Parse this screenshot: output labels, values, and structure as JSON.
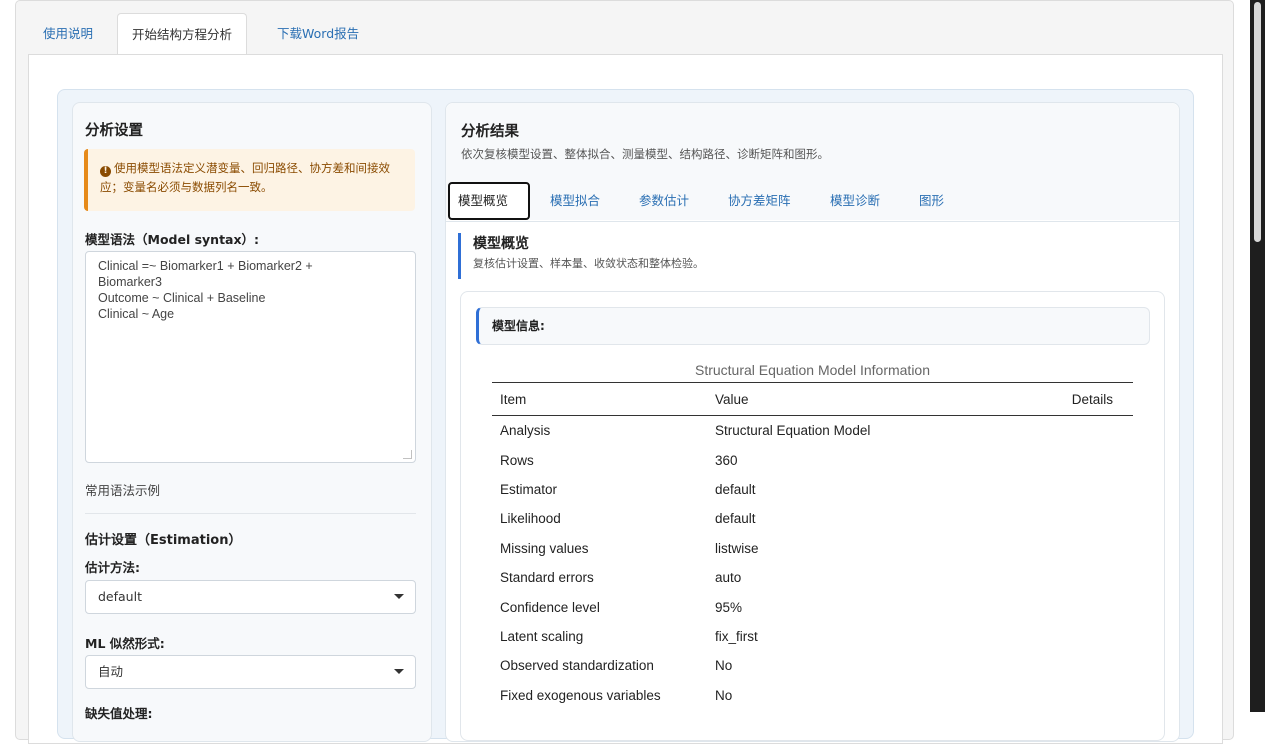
{
  "top_tabs": [
    {
      "label": "使用说明"
    },
    {
      "label": "开始结构方程分析"
    },
    {
      "label": "下载Word报告"
    }
  ],
  "settings": {
    "title": "分析设置",
    "notice": "使用模型语法定义潜变量、回归路径、协方差和间接效应；变量名必须与数据列名一致。",
    "syntax_label": "模型语法（Model syntax）:",
    "syntax_value": "Clinical =~ Biomarker1 + Biomarker2 +\nBiomarker3\nOutcome ~ Clinical + Baseline\nClinical ~ Age",
    "examples_link": "常用语法示例",
    "estimation_heading": "估计设置（Estimation）",
    "estimator_label": "估计方法:",
    "estimator_value": "default",
    "likelihood_label": "ML 似然形式:",
    "likelihood_value": "自动",
    "missing_label": "缺失值处理:"
  },
  "results": {
    "title": "分析结果",
    "subtitle": "依次复核模型设置、整体拟合、测量模型、结构路径、诊断矩阵和图形。",
    "tabs": [
      {
        "label": "模型概览"
      },
      {
        "label": "模型拟合"
      },
      {
        "label": "参数估计"
      },
      {
        "label": "协方差矩阵"
      },
      {
        "label": "模型诊断"
      },
      {
        "label": "图形"
      }
    ],
    "section_title": "模型概览",
    "section_subtitle": "复核估计设置、样本量、收敛状态和整体检验。",
    "info_label": "模型信息:",
    "table": {
      "caption": "Structural Equation Model Information",
      "headers": [
        "Item",
        "Value",
        "Details"
      ],
      "rows": [
        [
          "Analysis",
          "Structural Equation Model",
          ""
        ],
        [
          "Rows",
          "360",
          ""
        ],
        [
          "Estimator",
          "default",
          ""
        ],
        [
          "Likelihood",
          "default",
          ""
        ],
        [
          "Missing values",
          "listwise",
          ""
        ],
        [
          "Standard errors",
          "auto",
          ""
        ],
        [
          "Confidence level",
          "95%",
          ""
        ],
        [
          "Latent scaling",
          "fix_first",
          ""
        ],
        [
          "Observed standardization",
          "No",
          ""
        ],
        [
          "Fixed exogenous variables",
          "No",
          ""
        ]
      ]
    }
  },
  "colors": {
    "link": "#2a6fb3",
    "accent": "#2f6fd6",
    "warning_border": "#e68a1a",
    "warning_bg": "#fdf3e4"
  },
  "icons": [
    "warning-circle-icon",
    "caret-down-icon",
    "resize-grip-icon"
  ]
}
